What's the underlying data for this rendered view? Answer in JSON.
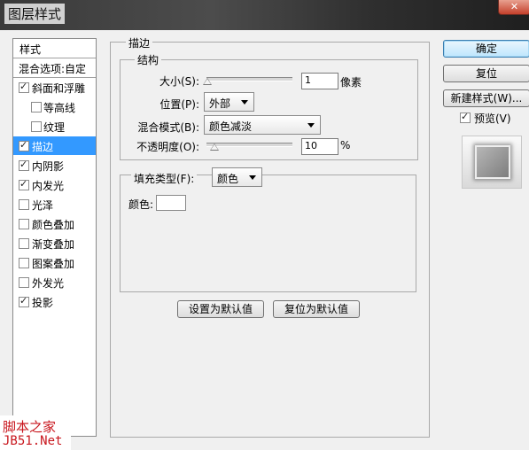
{
  "window": {
    "title": "图层样式",
    "close": "✕"
  },
  "style_list": {
    "header": "样式",
    "blend_options": "混合选项:自定",
    "items": [
      {
        "label": "斜面和浮雕",
        "checked": true
      },
      {
        "label": "等高线",
        "checked": false,
        "indent": true
      },
      {
        "label": "纹理",
        "checked": false,
        "indent": true
      },
      {
        "label": "描边",
        "checked": true,
        "selected": true
      },
      {
        "label": "内阴影",
        "checked": true
      },
      {
        "label": "内发光",
        "checked": true
      },
      {
        "label": "光泽",
        "checked": false
      },
      {
        "label": "颜色叠加",
        "checked": false
      },
      {
        "label": "渐变叠加",
        "checked": false
      },
      {
        "label": "图案叠加",
        "checked": false
      },
      {
        "label": "外发光",
        "checked": false
      },
      {
        "label": "投影",
        "checked": true
      }
    ]
  },
  "stroke": {
    "group_title": "描边",
    "structure_title": "结构",
    "size_label": "大小(S):",
    "size_value": "1",
    "size_unit": "像素",
    "position_label": "位置(P):",
    "position_value": "外部",
    "blend_label": "混合模式(B):",
    "blend_value": "颜色减淡",
    "opacity_label": "不透明度(O):",
    "opacity_value": "10",
    "opacity_unit": "%",
    "fill_type_label": "填充类型(F):",
    "fill_type_value": "颜色",
    "color_label": "颜色:",
    "color_value": "#ffffff",
    "set_default": "设置为默认值",
    "reset_default": "复位为默认值"
  },
  "right": {
    "ok": "确定",
    "reset": "复位",
    "new_style": "新建样式(W)...",
    "preview_label": "预览(V)",
    "preview_checked": true
  },
  "watermark": {
    "line1": "脚本之家",
    "line2": "JB51.Net"
  }
}
